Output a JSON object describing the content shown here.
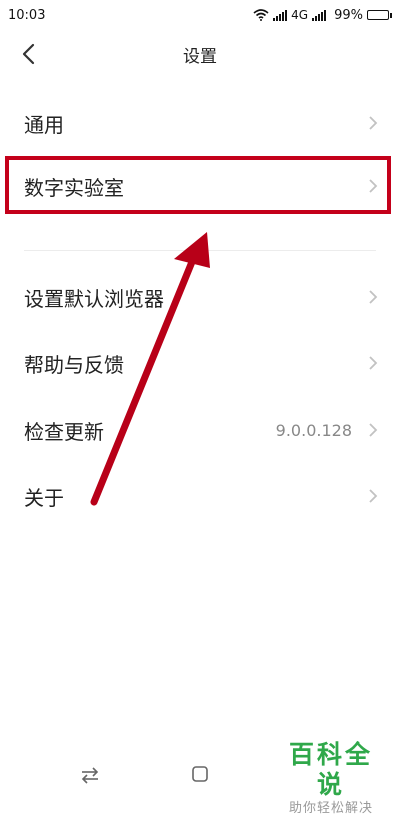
{
  "status_bar": {
    "time": "10:03",
    "network": "4G",
    "battery": "99%",
    "battery_level": 0.99,
    "icons": [
      "wifi-icon",
      "signal-icon",
      "signal-icon",
      "battery-icon"
    ]
  },
  "header": {
    "title": "设置",
    "back_icon": "chevron-left-icon"
  },
  "settings": {
    "items": [
      {
        "label": "通用",
        "value": ""
      },
      {
        "label": "数字实验室",
        "value": "",
        "highlighted": true
      },
      {
        "label": "设置默认浏览器",
        "value": ""
      },
      {
        "label": "帮助与反馈",
        "value": ""
      },
      {
        "label": "检查更新",
        "value": "9.0.0.128"
      },
      {
        "label": "关于",
        "value": ""
      }
    ],
    "chevron_icon": "chevron-right-icon"
  },
  "annotation": {
    "color": "#c4001a",
    "box_icon": "highlight-box",
    "arrow_icon": "arrow-icon"
  },
  "nav_bar": {
    "icons": [
      "switch-apps-icon",
      "home-icon"
    ]
  },
  "watermark": {
    "title": "百科全说",
    "subtitle": "助你轻松解决",
    "color": "#2fa84a"
  }
}
